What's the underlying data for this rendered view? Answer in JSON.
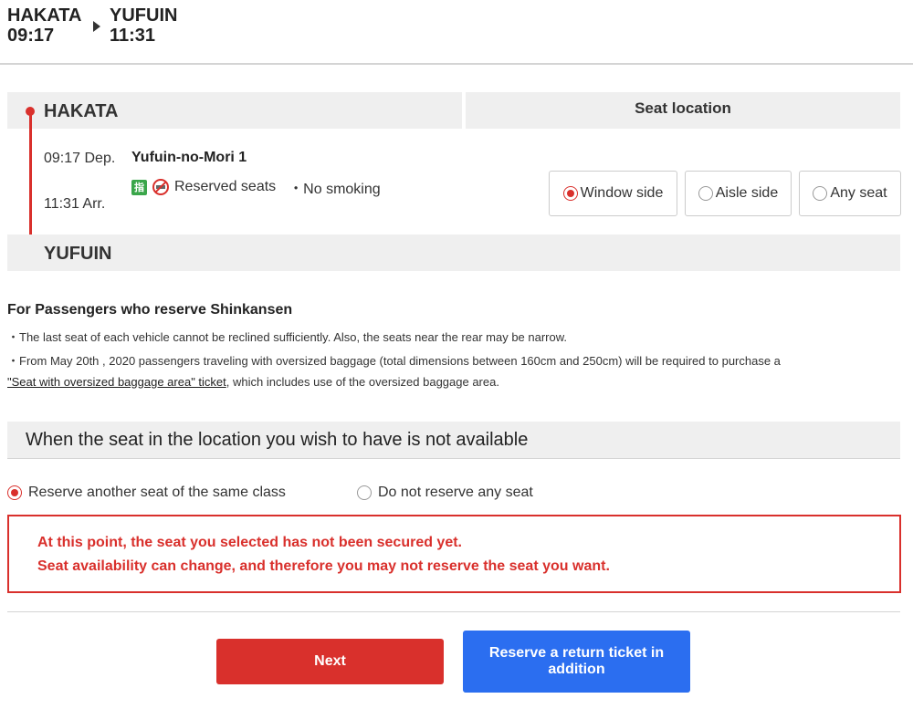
{
  "header": {
    "from_station": "HAKATA",
    "from_time": "09:17",
    "to_station": "YUFUIN",
    "to_time": "11:31",
    "arrow_icon": "triangle-right-icon"
  },
  "train": {
    "origin": "HAKATA",
    "destination": "YUFUIN",
    "dep_time": "09:17 Dep.",
    "arr_time": "11:31 Arr.",
    "name": "Yufuin-no-Mori 1",
    "reserved_icon_text": "指",
    "seat_type": "Reserved seats",
    "smoking": "・No smoking"
  },
  "seat_location": {
    "title": "Seat location",
    "options": [
      {
        "label": "Window side",
        "selected": true
      },
      {
        "label": "Aisle side",
        "selected": false
      },
      {
        "label": "Any seat",
        "selected": false
      }
    ]
  },
  "notes": {
    "title": "For Passengers who reserve Shinkansen",
    "line1": "・The last seat of each vehicle cannot be reclined sufficiently. Also, the seats near the rear may be narrow.",
    "line2": "・From May 20th , 2020 passengers traveling with oversized baggage (total dimensions between 160cm and 250cm) will be required to purchase a",
    "line3_link": "\"Seat with oversized baggage area\" ticket",
    "line3_rest": ", which includes use of the oversized baggage area."
  },
  "unavailable": {
    "title": "When the seat in the location you wish to have is not available",
    "options": [
      {
        "label": "Reserve another seat of the same class",
        "selected": true
      },
      {
        "label": "Do not reserve any seat",
        "selected": false
      }
    ]
  },
  "warning": {
    "line1": "At this point, the seat you selected has not been secured yet.",
    "line2": "Seat availability can change, and therefore you may not reserve the seat you want."
  },
  "buttons": {
    "next": "Next",
    "return_ticket": "Reserve a return ticket in addition"
  },
  "colors": {
    "accent_red": "#d9302c",
    "accent_blue": "#2b6ef0",
    "section_bg": "#efefef"
  }
}
